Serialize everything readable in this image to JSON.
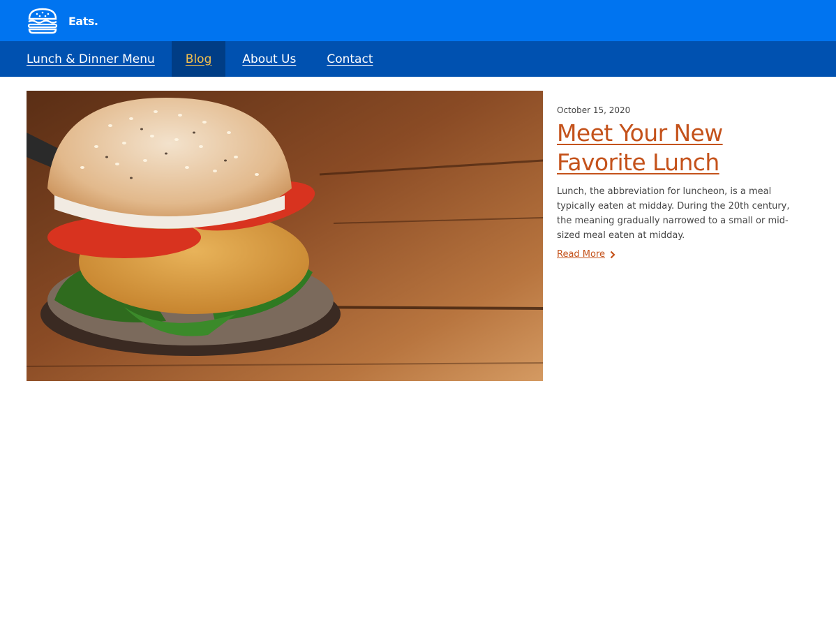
{
  "header": {
    "brand": "Eats.",
    "logo_icon": "burger-icon"
  },
  "nav": {
    "items": [
      {
        "label": "Lunch & Dinner Menu"
      },
      {
        "label": "Blog",
        "active": true
      },
      {
        "label": "About Us"
      },
      {
        "label": "Contact"
      }
    ]
  },
  "post": {
    "image_alt": "burger photo",
    "date": "October 15, 2020",
    "title": "Meet Your New Favorite Lunch",
    "excerpt": "Lunch, the abbreviation for luncheon, is a meal typically eaten at midday. During the 20th century, the meaning gradually narrowed to a small or mid-sized meal eaten at midday.",
    "read_more": "Read More",
    "read_more_icon": "chevron-right-icon"
  },
  "colors": {
    "topbar": "#0074f0",
    "navbar": "#0051b0",
    "nav_active_bg": "#003d85",
    "nav_active_text": "#f4c14d",
    "accent": "#c4521b"
  }
}
